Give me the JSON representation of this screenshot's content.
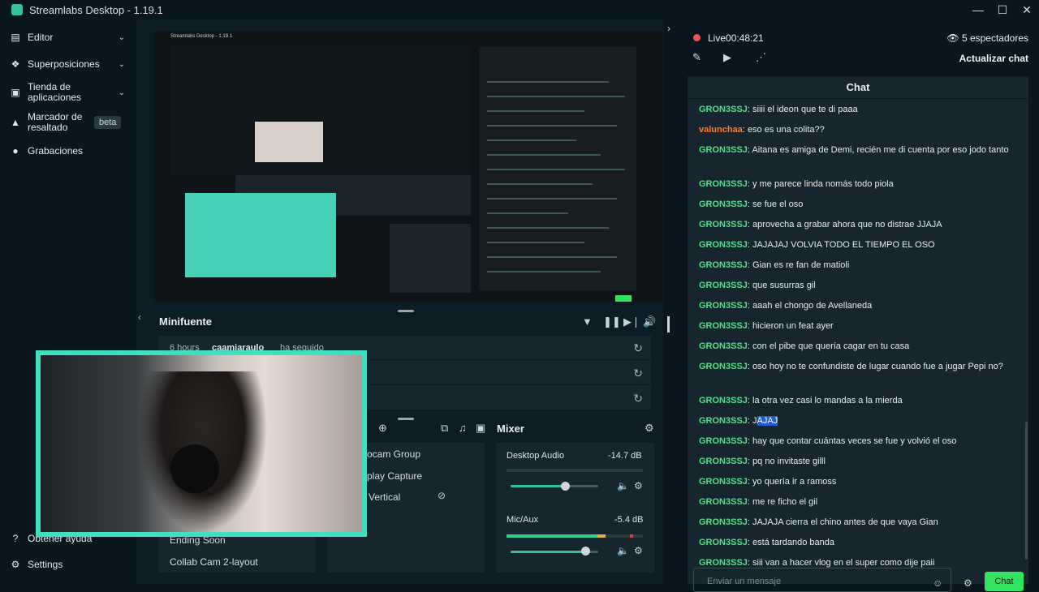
{
  "window": {
    "title": "Streamlabs Desktop - 1.19.1",
    "controls": [
      "—",
      "☐",
      "✕"
    ]
  },
  "sidebar": {
    "items": [
      {
        "label": "Editor",
        "icon": "edit-icon",
        "expandable": true
      },
      {
        "label": "Superposiciones",
        "icon": "overlays-icon",
        "expandable": true
      },
      {
        "label": "Tienda de aplicaciones",
        "icon": "store-icon",
        "expandable": true
      },
      {
        "label": "Marcador de resaltado",
        "icon": "highlighter-icon",
        "badge": "beta"
      },
      {
        "label": "Grabaciones",
        "icon": "recordings-icon"
      }
    ],
    "bottom": [
      {
        "label": "Obtener ayuda",
        "icon": "help-icon"
      },
      {
        "label": "Settings",
        "icon": "gear-icon"
      }
    ]
  },
  "preview": {
    "inner_title": "Streamlabs Desktop - 1.19.1"
  },
  "minifuente": {
    "title": "Minifuente",
    "events": [
      {
        "time": "6 hours",
        "user": "caamiaraulo",
        "action": "ha seguido"
      }
    ]
  },
  "scenes": {
    "items": [
      "Ending Soon",
      "Collab Cam 2-layout"
    ]
  },
  "sources": {
    "items": [
      "Webcam Group",
      "Display Capture",
      "Vertical"
    ],
    "visible_prefixes": [
      "ocam Group",
      "play Capture",
      "Vertical"
    ]
  },
  "mixer": {
    "title": "Mixer",
    "channels": [
      {
        "name": "Desktop Audio",
        "db": "-14.7 dB",
        "level": 0.55
      },
      {
        "name": "Mic/Aux",
        "db": "-5.4 dB",
        "level": 0.75
      }
    ]
  },
  "stream": {
    "live_label": "Live",
    "live_time": "00:48:21",
    "viewers": "5 espectadores",
    "refresh_chat": "Actualizar chat"
  },
  "chat": {
    "title": "Chat",
    "messages": [
      {
        "user": "GRON3SSJ",
        "text": "siiii el ideon que te di paaa"
      },
      {
        "user": "valunchaa",
        "text": "eso es una colita??",
        "color": "orange"
      },
      {
        "user": "GRON3SSJ",
        "text": "Aitana es amiga de Demi, recién me di cuenta por eso jodo tanto"
      },
      {
        "user": "GRON3SSJ",
        "text": "y me parece linda nomás todo piola"
      },
      {
        "user": "GRON3SSJ",
        "text": "se fue el oso"
      },
      {
        "user": "GRON3SSJ",
        "text": "aprovecha a grabar ahora que no distrae JJAJA"
      },
      {
        "user": "GRON3SSJ",
        "text": "JAJAJAJ VOLVIA TODO EL TIEMPO EL OSO"
      },
      {
        "user": "GRON3SSJ",
        "text": "Gian es re fan de matioli"
      },
      {
        "user": "GRON3SSJ",
        "text": "que susurras gil"
      },
      {
        "user": "GRON3SSJ",
        "text": "aaah el chongo de Avellaneda"
      },
      {
        "user": "GRON3SSJ",
        "text": "hicieron un feat ayer"
      },
      {
        "user": "GRON3SSJ",
        "text": "con el pibe que quería cagar en tu casa"
      },
      {
        "user": "GRON3SSJ",
        "text": "oso hoy no te confundiste de lugar cuando fue a jugar Pepi no?"
      },
      {
        "user": "GRON3SSJ",
        "text": "la otra vez casi lo mandas a la mierda"
      },
      {
        "user": "GRON3SSJ",
        "text": "JAJAJ",
        "highlight": "JAJAJ"
      },
      {
        "user": "GRON3SSJ",
        "text": "hay que contar cuántas veces se fue y volvió el oso"
      },
      {
        "user": "GRON3SSJ",
        "text": "pq no invitaste gilll"
      },
      {
        "user": "GRON3SSJ",
        "text": "yo quería ir a ramoss"
      },
      {
        "user": "GRON3SSJ",
        "text": "me re ficho el gil"
      },
      {
        "user": "GRON3SSJ",
        "text": "JAJAJA cierra el chino antes de que vaya Gian"
      },
      {
        "user": "GRON3SSJ",
        "text": "está tardando banda"
      },
      {
        "user": "GRON3SSJ",
        "text": "siii van a hacer vlog en el super como dije paii"
      }
    ],
    "input_placeholder": "Enviar un mensaje",
    "send_label": "Chat"
  }
}
